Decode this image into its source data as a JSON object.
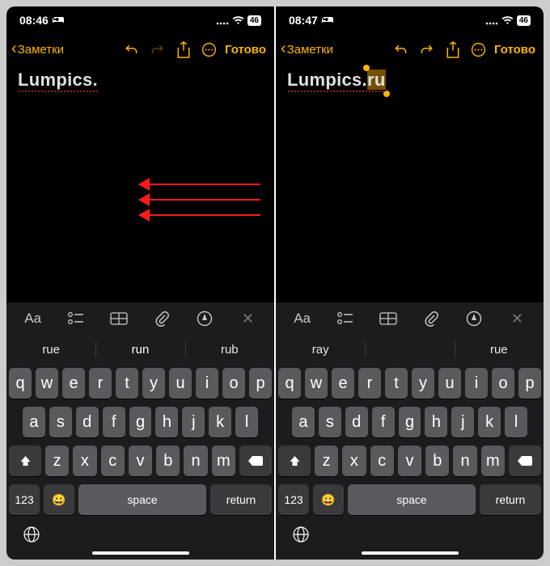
{
  "screens": [
    {
      "status": {
        "time": "08:46",
        "battery": "46",
        "bed_icon": "bed-icon"
      },
      "nav": {
        "back": "Заметки",
        "done": "Готово",
        "redo_enabled": false
      },
      "note": {
        "prefix": "Lumpics.",
        "suffix": ""
      },
      "suggestions": [
        "rue",
        "run",
        "rub"
      ],
      "show_arrows": true,
      "selection": false
    },
    {
      "status": {
        "time": "08:47",
        "battery": "46",
        "bed_icon": "bed-icon"
      },
      "nav": {
        "back": "Заметки",
        "done": "Готово",
        "redo_enabled": true
      },
      "note": {
        "prefix": "Lumpics.",
        "suffix": "ru"
      },
      "suggestions": [
        "ray",
        "",
        "rue"
      ],
      "show_arrows": false,
      "selection": true
    }
  ],
  "keyboard": {
    "row1": [
      "q",
      "w",
      "e",
      "r",
      "t",
      "y",
      "u",
      "i",
      "o",
      "p"
    ],
    "row2": [
      "a",
      "s",
      "d",
      "f",
      "g",
      "h",
      "j",
      "k",
      "l"
    ],
    "row3": [
      "z",
      "x",
      "c",
      "v",
      "b",
      "n",
      "m"
    ],
    "numbers": "123",
    "space": "space",
    "return": "return"
  },
  "colors": {
    "accent": "#ffb300"
  }
}
